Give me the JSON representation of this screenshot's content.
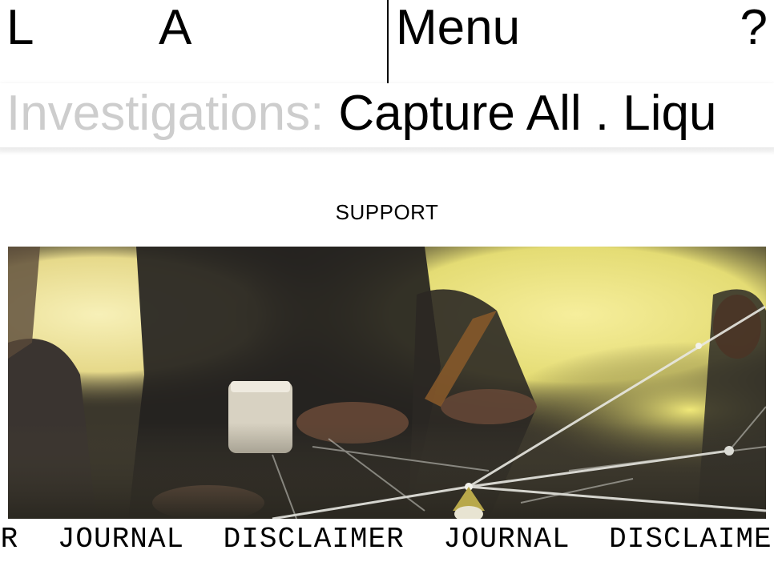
{
  "header": {
    "left_letter": "L",
    "mid_letter": "A",
    "menu_label": "Menu",
    "help_label": "?"
  },
  "ticker": {
    "label": "Investigations:",
    "text": "Capture All . Liqu"
  },
  "support": {
    "label": "SUPPORT"
  },
  "hero": {
    "image": "photo-people-with-strings-network"
  },
  "footer_marquee": {
    "items": [
      "ER",
      "JOURNAL",
      "DISCLAIMER",
      "JOURNAL",
      "DISCLAIME"
    ]
  },
  "colors": {
    "ticker_label": "#cdcdcd",
    "text": "#000000",
    "background": "#ffffff"
  }
}
